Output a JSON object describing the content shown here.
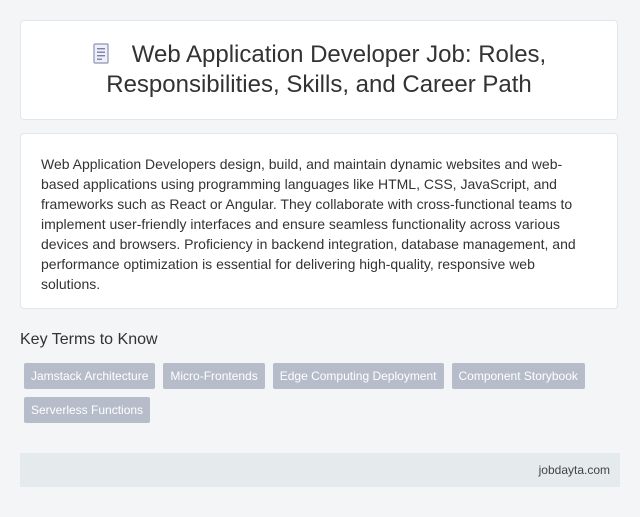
{
  "header": {
    "icon": "document-icon",
    "title": "Web Application Developer Job: Roles, Responsibilities, Skills, and Career Path"
  },
  "summary": {
    "text": "Web Application Developers design, build, and maintain dynamic websites and web-based applications using programming languages like HTML, CSS, JavaScript, and frameworks such as React or Angular. They collaborate with cross-functional teams to implement user-friendly interfaces and ensure seamless functionality across various devices and browsers. Proficiency in backend integration, database management, and performance optimization is essential for delivering high-quality, responsive web solutions."
  },
  "key_terms": {
    "heading": "Key Terms to Know",
    "tags": [
      "Jamstack Architecture",
      "Micro-Frontends",
      "Edge Computing Deployment",
      "Component Storybook",
      "Serverless Functions"
    ]
  },
  "footer": {
    "site": "jobdayta.com"
  },
  "colors": {
    "background": "#f3f5f7",
    "card": "#ffffff",
    "tag": "#b7bccb",
    "footer": "#e5eaec"
  }
}
